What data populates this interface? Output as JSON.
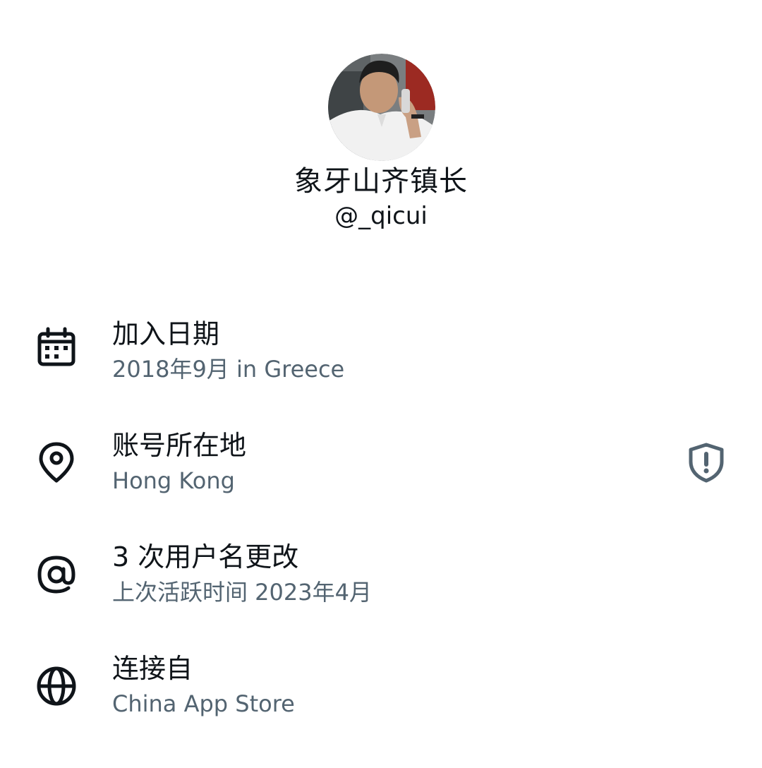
{
  "profile": {
    "display_name": "象牙山齐镇长",
    "handle": "@_qicui",
    "avatar_icon": "profile-photo"
  },
  "rows": [
    {
      "icon": "calendar-icon",
      "title": "加入日期",
      "subtitle": "2018年9月 in Greece"
    },
    {
      "icon": "location-pin-icon",
      "title": "账号所在地",
      "subtitle": "Hong Kong",
      "trailing_icon": "shield-alert-icon"
    },
    {
      "icon": "at-sign-icon",
      "title": "3 次用户名更改",
      "subtitle": "上次活跃时间 2023年4月"
    },
    {
      "icon": "globe-icon",
      "title": "连接自",
      "subtitle": "China App Store"
    }
  ],
  "colors": {
    "primary_text": "#0f1419",
    "secondary_text": "#536471",
    "icon": "#0f1419",
    "shield_icon": "#536471"
  }
}
